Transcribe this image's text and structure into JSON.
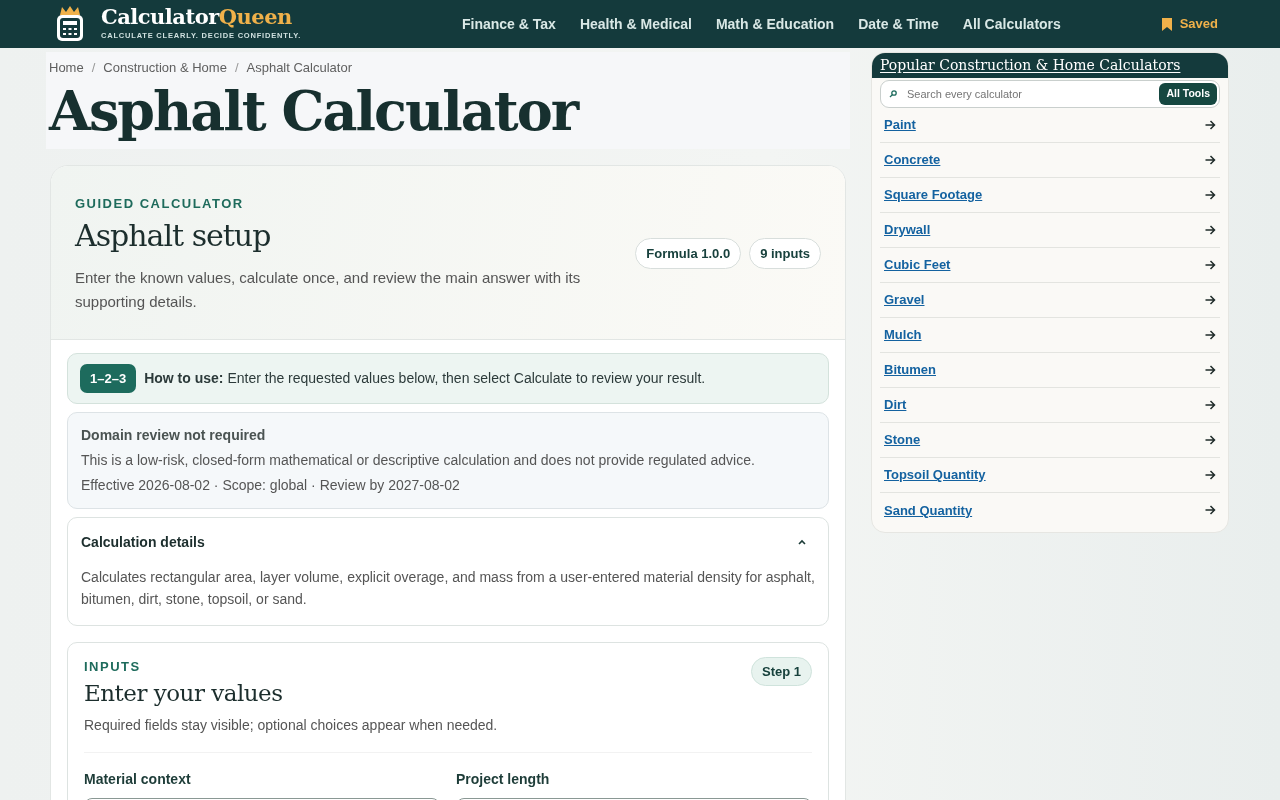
{
  "header": {
    "brand_first": "Calculator",
    "brand_second": "Queen",
    "tagline": "CALCULATE CLEARLY. DECIDE CONFIDENTLY.",
    "nav": [
      {
        "label": "Finance & Tax"
      },
      {
        "label": "Health & Medical"
      },
      {
        "label": "Math & Education"
      },
      {
        "label": "Date & Time"
      },
      {
        "label": "All Calculators"
      }
    ],
    "saved": "Saved"
  },
  "breadcrumb": {
    "separator": "/",
    "items": [
      "Home",
      "Construction & Home",
      "Asphalt Calculator"
    ]
  },
  "page_title": "Asphalt Calculator",
  "setup": {
    "eyebrow": "GUIDED CALCULATOR",
    "title": "Asphalt setup",
    "description": "Enter the known values, calculate once, and review the main answer with its supporting details.",
    "badges": [
      "Formula 1.0.0",
      "9 inputs"
    ]
  },
  "how_to": {
    "badge": "1–2–3",
    "text": "**How to use:** Enter the requested values below, then select Calculate to review your result."
  },
  "review": {
    "title": "Domain review not required",
    "text": "This is a low-risk, closed-form mathematical or descriptive calculation and does not provide regulated advice.",
    "meta": "Effective 2026-08-02 · Scope: global · Review by 2027-08-02"
  },
  "details": {
    "title": "Calculation details",
    "expanded": true,
    "text": "Calculates rectangular area, layer volume, explicit overage, and mass from a user-entered material density for asphalt, bitumen, dirt, stone, topsoil, or sand."
  },
  "inputs": {
    "eyebrow": "INPUTS",
    "title": "Enter your values",
    "step": "Step 1",
    "hint": "Required fields stay visible; optional choices appear when needed.",
    "fields": [
      {
        "label": "Material context"
      },
      {
        "label": "Project length"
      }
    ]
  },
  "sidebar": {
    "title": "Popular Construction & Home Calculators",
    "search_placeholder": "Search every calculator",
    "search_button": "All Tools",
    "items": [
      "Paint",
      "Concrete",
      "Square Footage",
      "Drywall",
      "Cubic Feet",
      "Gravel",
      "Mulch",
      "Bitumen",
      "Dirt",
      "Stone",
      "Topsoil Quantity",
      "Sand Quantity"
    ]
  }
}
